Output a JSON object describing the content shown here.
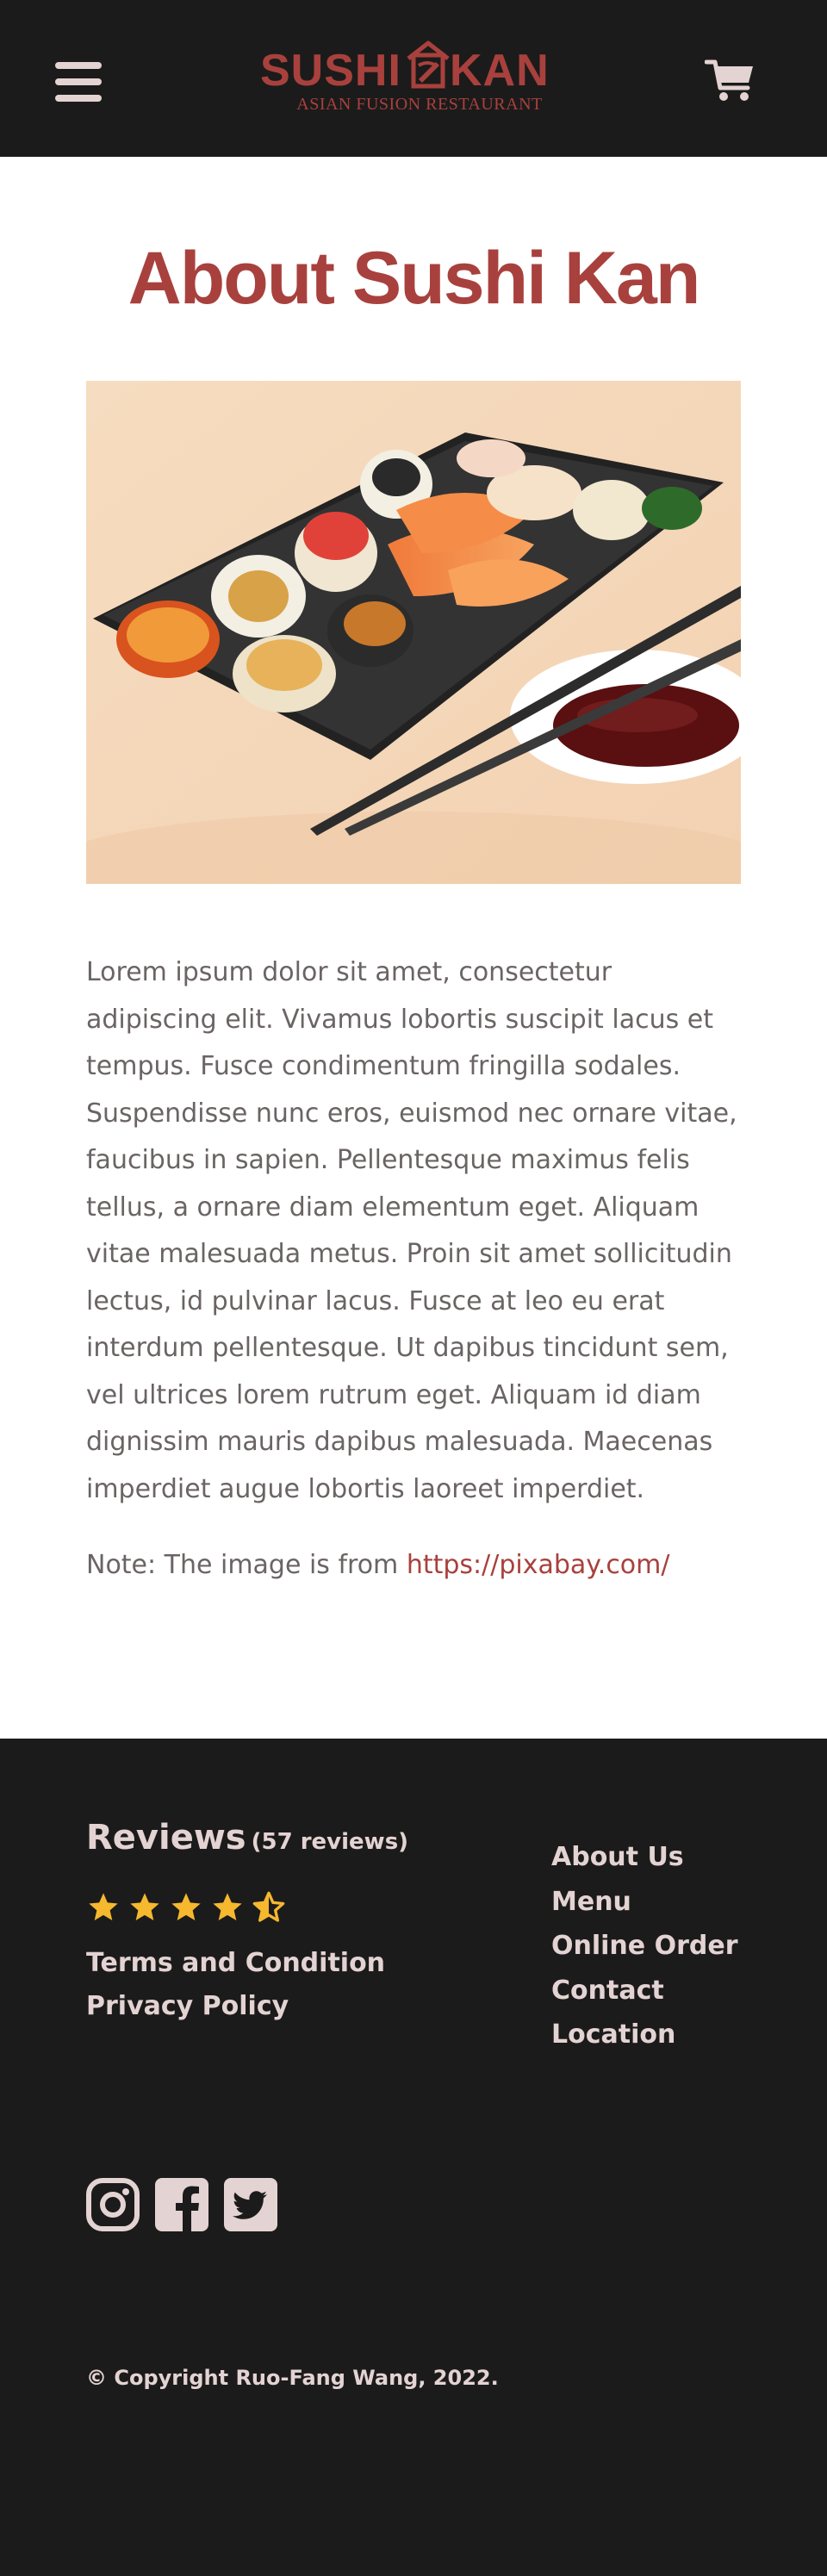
{
  "header": {
    "logo": {
      "word_left": "SUSHI",
      "word_right": "KAN",
      "subtitle": "ASIAN FUSION RESTAURANT"
    },
    "menu_icon": "hamburger-icon",
    "cart_icon": "cart-icon"
  },
  "main": {
    "title": "About Sushi Kan",
    "hero_image": "sushi-platter-with-chopsticks-and-soy-sauce",
    "body": "Lorem ipsum dolor sit amet, consectetur adipiscing elit. Vivamus lobortis suscipit lacus et tempus. Fusce condimentum fringilla sodales. Suspendisse nunc eros, euismod nec ornare vitae, faucibus in sapien. Pellentesque maximus felis tellus, a ornare diam elementum eget. Aliquam vitae malesuada metus. Proin sit amet sollicitudin lectus, id pulvinar lacus. Fusce at leo eu erat interdum pellentesque. Ut dapibus tincidunt sem, vel ultrices lorem rutrum eget. Aliquam id diam dignissim mauris dapibus malesuada. Maecenas imperdiet augue lobortis laoreet imperdiet.",
    "note_prefix": "Note: The image is from ",
    "note_link": "https://pixabay.com/"
  },
  "footer": {
    "reviews_title": "Reviews",
    "reviews_count": "(57 reviews)",
    "rating": 4.5,
    "rating_max": 5,
    "legal_links": [
      "Terms and Condition",
      "Privacy Policy"
    ],
    "nav_links": [
      "About Us",
      "Menu",
      "Online Order",
      "Contact",
      "Location"
    ],
    "social": [
      "instagram-icon",
      "facebook-icon",
      "twitter-icon"
    ],
    "copyright": "© Copyright Ruo-Fang Wang, 2022."
  },
  "colors": {
    "brand": "#a8413d",
    "dark_bg": "#1c1b1b",
    "light_text": "#e4d3d3",
    "body_text": "#6b6464",
    "star": "#f5b82e"
  }
}
